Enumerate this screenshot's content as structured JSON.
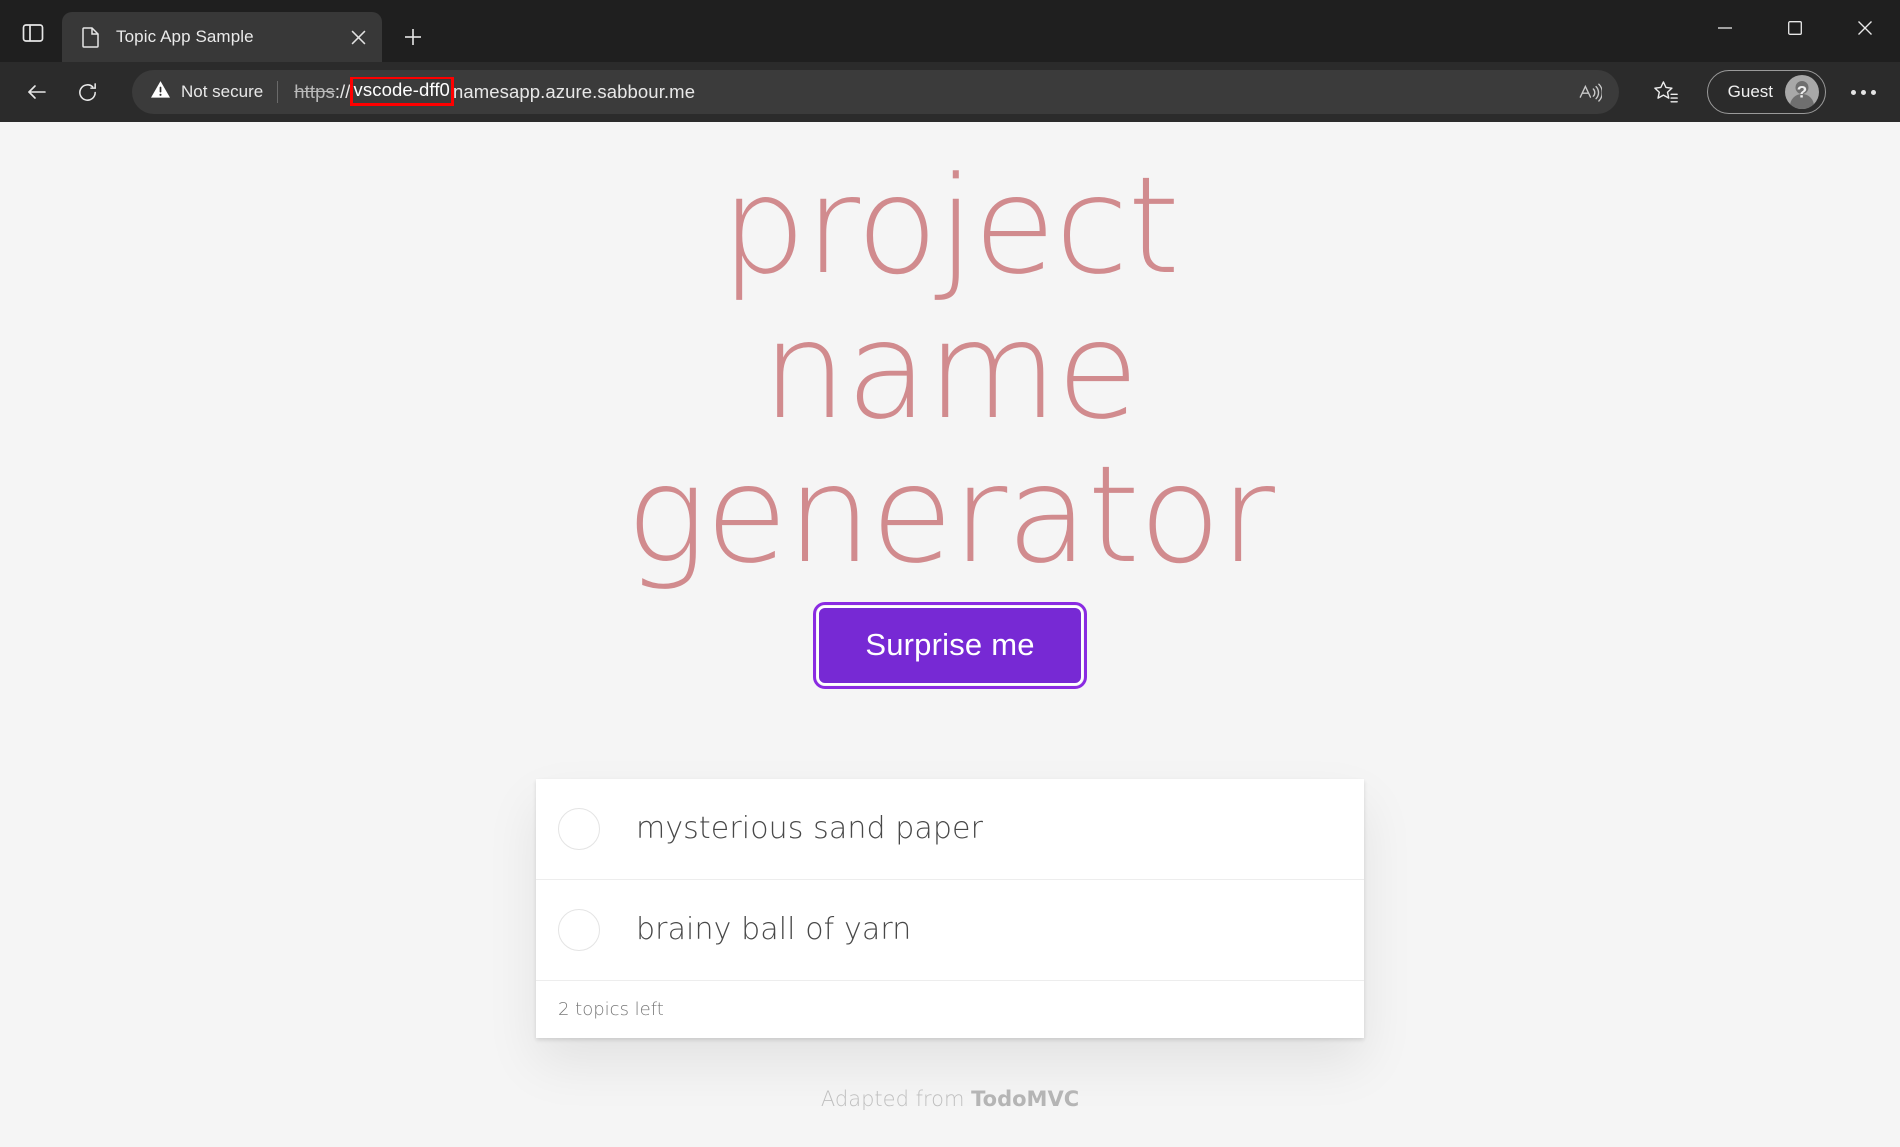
{
  "browser": {
    "tab": {
      "title": "Topic App Sample",
      "favicon_icon": "page-icon",
      "close_icon": "close-icon"
    },
    "sidebar_toggle_icon": "sidebar-panel-icon",
    "new_tab_icon": "plus-icon",
    "window_controls": {
      "minimize_icon": "minimize-icon",
      "maximize_icon": "maximize-icon",
      "close_icon": "close-icon"
    },
    "toolbar": {
      "back_icon": "back-arrow-icon",
      "refresh_icon": "refresh-icon",
      "security_icon": "warning-triangle-icon",
      "security_label": "Not secure",
      "url": {
        "scheme": "https",
        "separator": "://",
        "highlighted_segment": "vscode-dff0",
        "rest": "namesapp.azure.sabbour.me",
        "full": "https://vscode-dff0namesapp.azure.sabbour.me",
        "highlight_color": "#ff0000"
      },
      "read_aloud_icon": "read-aloud-icon",
      "favorites_icon": "favorites-star-icon",
      "profile_label": "Guest",
      "profile_avatar_icon": "guest-avatar-icon",
      "settings_icon": "more-options-icon"
    }
  },
  "page": {
    "title": "project name generator",
    "surprise_button_label": "Surprise me",
    "accent_color": "#7729d4",
    "title_color": "#b83f45",
    "todos": [
      {
        "label": "mysterious sand paper",
        "completed": false,
        "toggle_icon": "checkbox-circle-icon"
      },
      {
        "label": "brainy ball of yarn",
        "completed": false,
        "toggle_icon": "checkbox-circle-icon"
      }
    ],
    "footer_count": "2 topics left",
    "credits": {
      "prefix": "Adapted from ",
      "source": "TodoMVC"
    }
  }
}
